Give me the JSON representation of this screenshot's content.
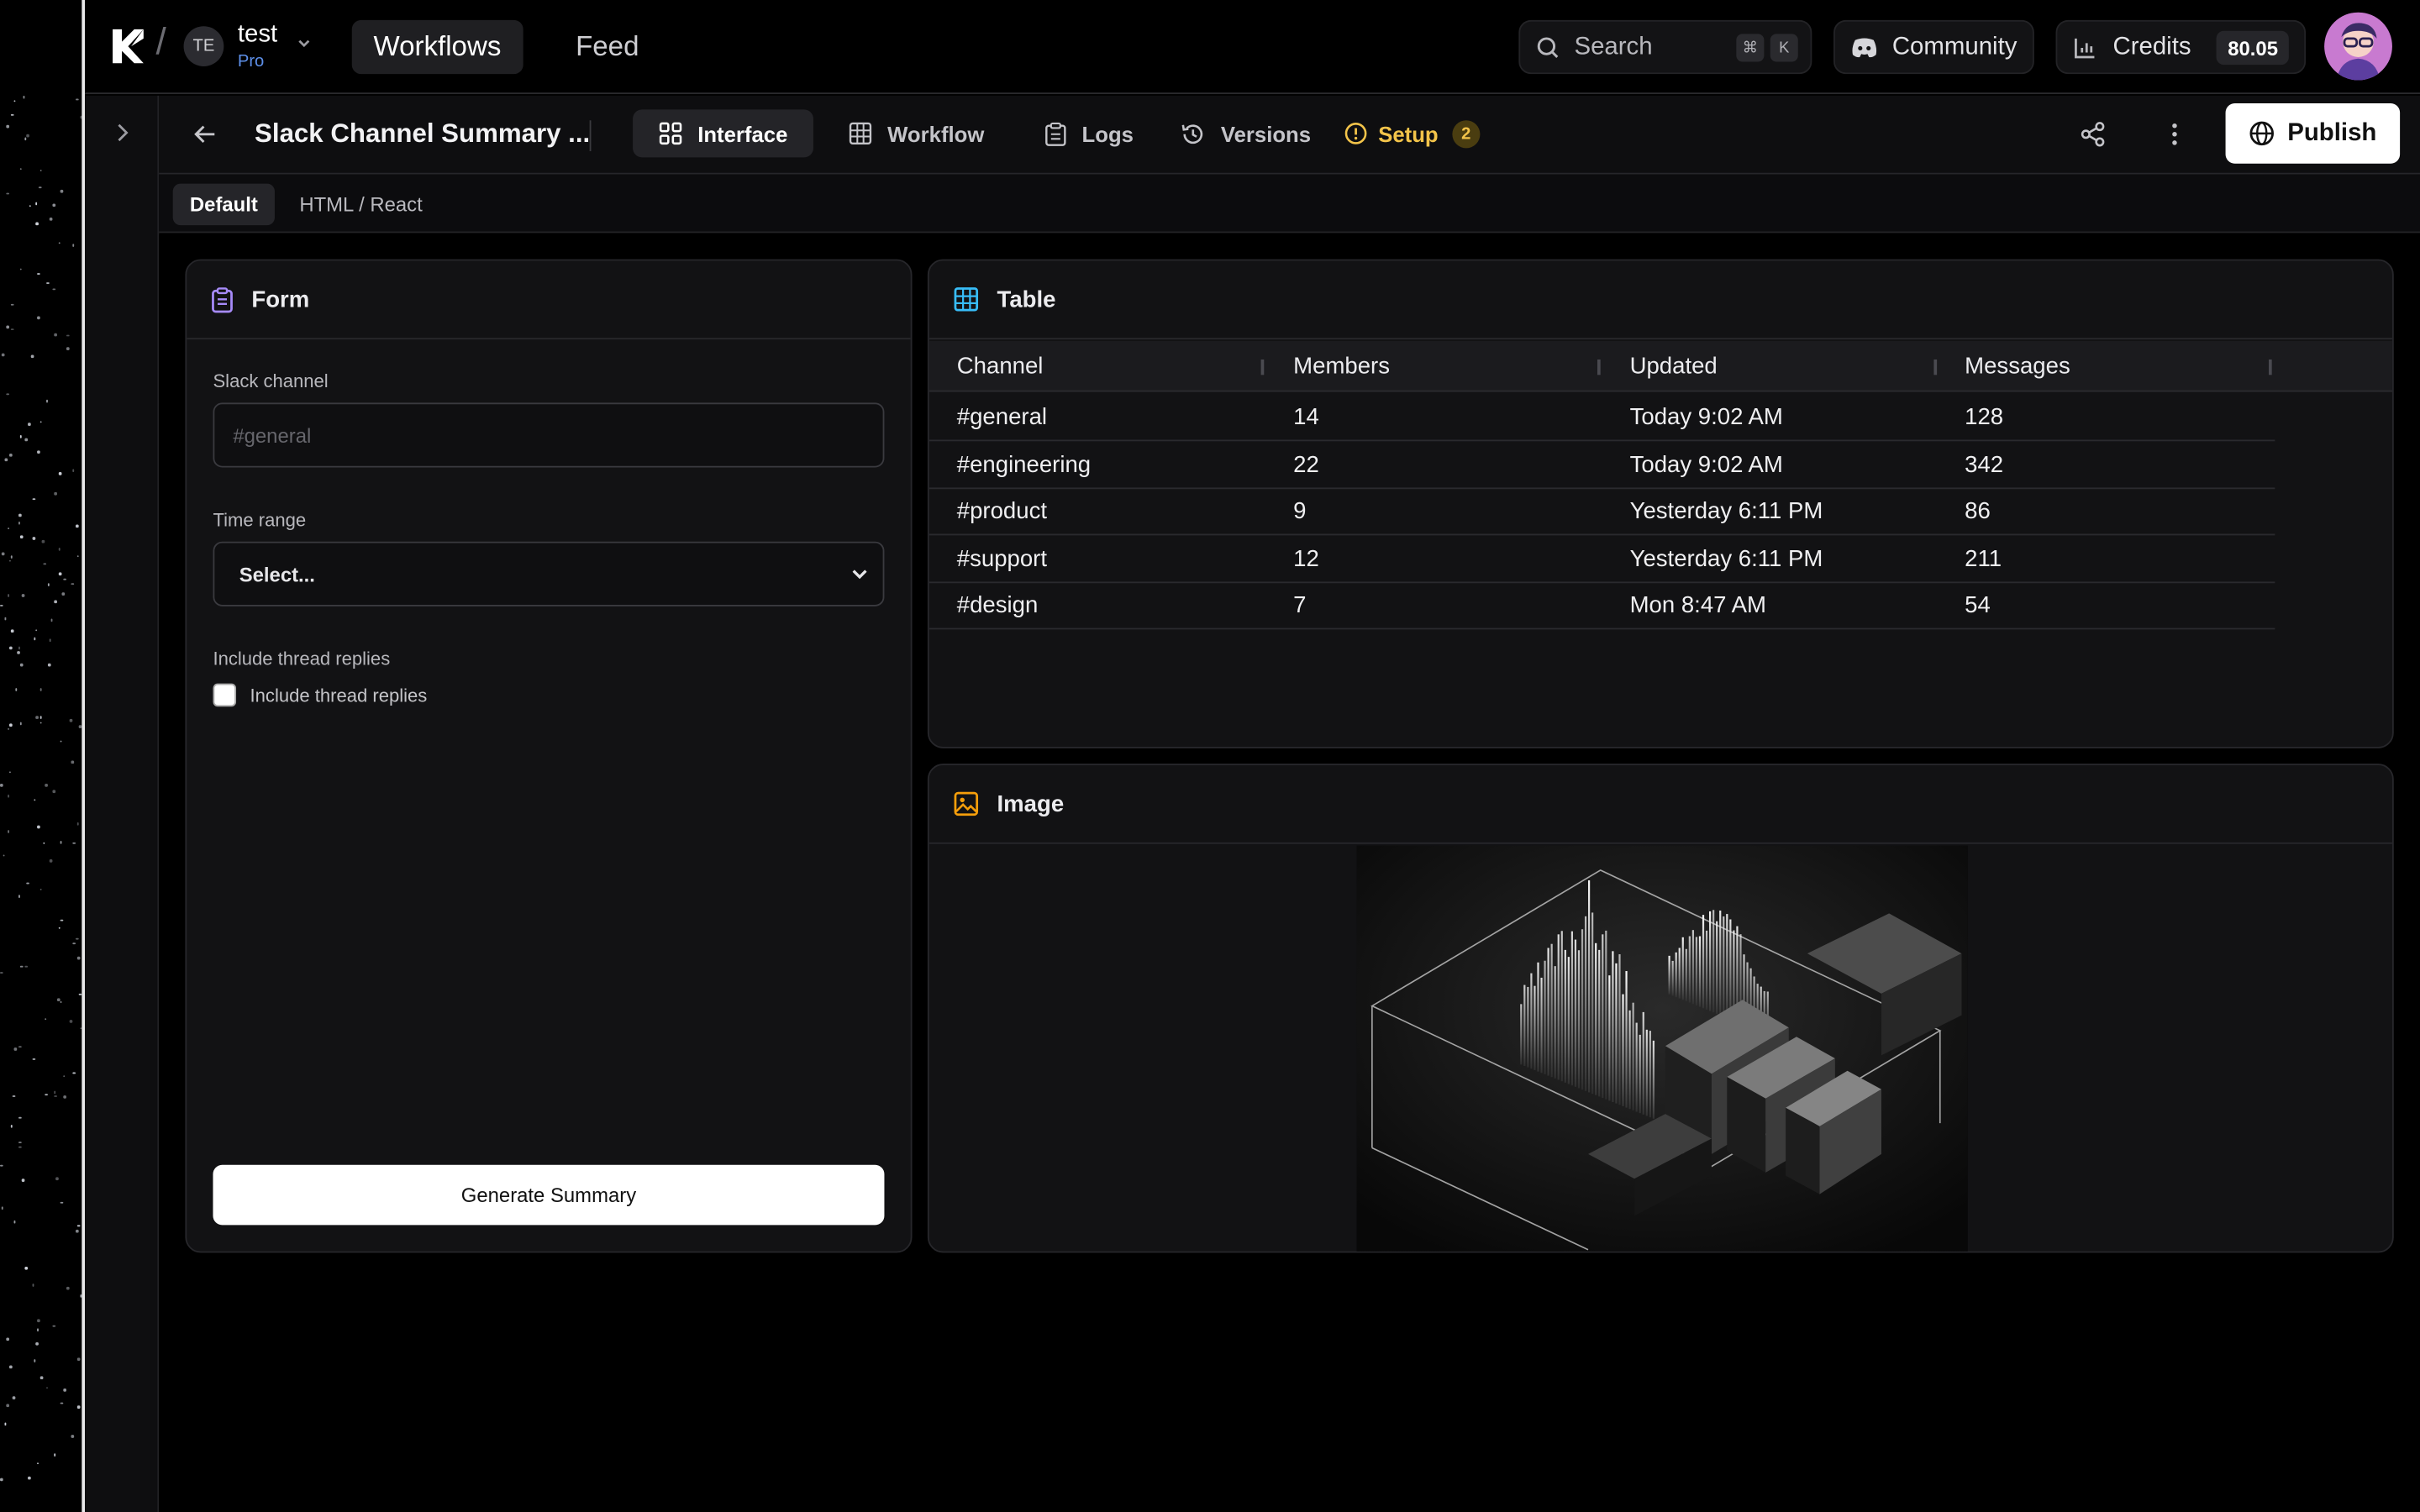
{
  "topbar": {
    "workspace_initials": "TE",
    "workspace_name": "test",
    "workspace_plan": "Pro",
    "nav": [
      "Workflows",
      "Feed"
    ],
    "search_label": "Search",
    "search_keys": [
      "⌘",
      "K"
    ],
    "community_label": "Community",
    "credits_label": "Credits",
    "credits_value": "80.05"
  },
  "appbar": {
    "title": "Slack Channel Summary ...",
    "tabs": [
      {
        "label": "Interface",
        "icon": "grid-icon"
      },
      {
        "label": "Workflow",
        "icon": "table-icon"
      },
      {
        "label": "Logs",
        "icon": "clipboard-icon"
      },
      {
        "label": "Versions",
        "icon": "history-icon"
      },
      {
        "label": "Setup",
        "icon": "alert-circle-icon"
      }
    ],
    "setup_count": "2",
    "publish_label": "Publish"
  },
  "viewtabs": [
    "Default",
    "HTML / React"
  ],
  "form": {
    "title": "Form",
    "channel_label": "Slack channel",
    "channel_placeholder": "#general",
    "time_label": "Time range",
    "time_value": "Select...",
    "thread_label": "Include thread replies",
    "thread_checkbox_label": "Include thread replies",
    "submit_label": "Generate Summary"
  },
  "table": {
    "title": "Table",
    "columns": [
      "Channel",
      "Members",
      "Updated",
      "Messages"
    ],
    "rows": [
      [
        "#general",
        "14",
        "Today 9:02 AM",
        "128"
      ],
      [
        "#engineering",
        "22",
        "Today 9:02 AM",
        "342"
      ],
      [
        "#product",
        "9",
        "Yesterday 6:11 PM",
        "86"
      ],
      [
        "#support",
        "12",
        "Yesterday 6:11 PM",
        "211"
      ],
      [
        "#design",
        "7",
        "Mon 8:47 AM",
        "54"
      ]
    ]
  },
  "image_card": {
    "title": "Image"
  },
  "colors": {
    "accent_setup": "#f3c44a",
    "plan_blue": "#5d8fe8",
    "form_icon": "#a78bfa",
    "table_icon": "#38bdf8",
    "image_icon": "#f59e0b"
  }
}
